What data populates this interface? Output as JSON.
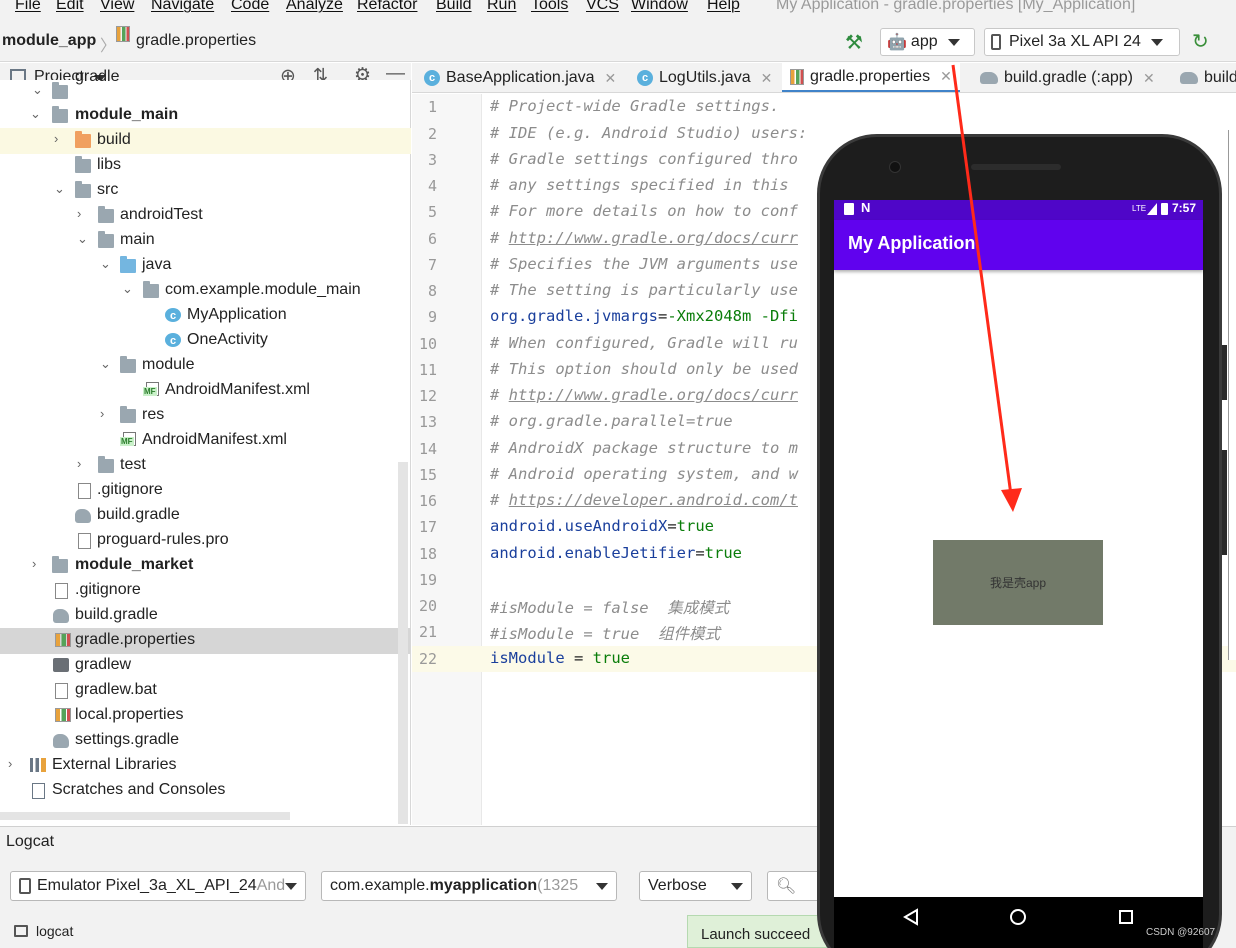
{
  "menu": {
    "items": [
      "File",
      "Edit",
      "View",
      "Navigate",
      "Code",
      "Analyze",
      "Refactor",
      "Build",
      "Run",
      "Tools",
      "VCS",
      "Window",
      "Help"
    ],
    "window_title": "My Application - gradle.properties [My_Application]"
  },
  "nav": {
    "breadcrumb_module": "module_app",
    "breadcrumb_file": "gradle.properties",
    "run_config": "app",
    "device": "Pixel 3a XL API 24"
  },
  "project": {
    "view_label": "Project",
    "tree": [
      {
        "label": "gradle",
        "bold": false
      },
      {
        "label": "module_main",
        "bold": true
      },
      {
        "label": "build",
        "bold": false
      },
      {
        "label": "libs",
        "bold": false
      },
      {
        "label": "src",
        "bold": false
      },
      {
        "label": "androidTest",
        "bold": false
      },
      {
        "label": "main",
        "bold": false
      },
      {
        "label": "java",
        "bold": false
      },
      {
        "label": "com.example.module_main",
        "bold": false
      },
      {
        "label": "MyApplication",
        "bold": false
      },
      {
        "label": "OneActivity",
        "bold": false
      },
      {
        "label": "module",
        "bold": false
      },
      {
        "label": "AndroidManifest.xml",
        "bold": false
      },
      {
        "label": "res",
        "bold": false
      },
      {
        "label": "AndroidManifest.xml",
        "bold": false
      },
      {
        "label": "test",
        "bold": false
      },
      {
        "label": ".gitignore",
        "bold": false
      },
      {
        "label": "build.gradle",
        "bold": false
      },
      {
        "label": "proguard-rules.pro",
        "bold": false
      },
      {
        "label": "module_market",
        "bold": true
      },
      {
        "label": ".gitignore",
        "bold": false
      },
      {
        "label": "build.gradle",
        "bold": false
      },
      {
        "label": "gradle.properties",
        "bold": false
      },
      {
        "label": "gradlew",
        "bold": false
      },
      {
        "label": "gradlew.bat",
        "bold": false
      },
      {
        "label": "local.properties",
        "bold": false
      },
      {
        "label": "settings.gradle",
        "bold": false
      },
      {
        "label": "External Libraries",
        "bold": false
      },
      {
        "label": "Scratches and Consoles",
        "bold": false
      }
    ]
  },
  "tabs": [
    "BaseApplication.java",
    "LogUtils.java",
    "gradle.properties",
    "build.gradle (:app)",
    "build"
  ],
  "editor": {
    "line_numbers": [
      "1",
      "2",
      "3",
      "4",
      "5",
      "6",
      "7",
      "8",
      "9",
      "10",
      "11",
      "12",
      "13",
      "14",
      "15",
      "16",
      "17",
      "18",
      "19",
      "20",
      "21",
      "22"
    ],
    "lines": [
      "# Project-wide Gradle settings.",
      "# IDE (e.g. Android Studio) users:",
      "# Gradle settings configured thro",
      "# any settings specified in this",
      "# For more details on how to conf",
      "http://www.gradle.org/docs/curr",
      "# Specifies the JVM arguments use",
      "# The setting is particularly use",
      "org.gradle.jvmargs",
      "# When configured, Gradle will ru",
      "# This option should only be used",
      "http://www.gradle.org/docs/curr",
      "# org.gradle.parallel=true",
      "# AndroidX package structure to m",
      "# Android operating system, and w",
      "https://developer.android.com/t",
      "android.useAndroidX",
      "android.enableJetifier",
      "",
      "#isModule = false  集成模式",
      "#isModule = true  组件模式",
      "isModule"
    ],
    "jvm_value": "-Xmx2048m -Dfi",
    "true_value": "true",
    "assign": " = "
  },
  "logcat": {
    "title": "Logcat",
    "device": "Emulator Pixel_3a_XL_API_24",
    "device_suffix": " And",
    "package_prefix": "com.example.",
    "package_bold": "myapplication",
    "package_pid": " (1325",
    "level": "Verbose",
    "bottom_tab": "logcat",
    "toast": "Launch succeed"
  },
  "phone": {
    "time": "7:57",
    "network": "LTE",
    "app_title": "My Application",
    "box_text": "我是壳app"
  },
  "watermark": "CSDN @92607",
  "colors": {
    "accent": "#4083c9",
    "app_bar": "#6002ee",
    "status_bar": "#4f06c8",
    "arrow": "#ff2a1a",
    "box": "#727a69"
  }
}
